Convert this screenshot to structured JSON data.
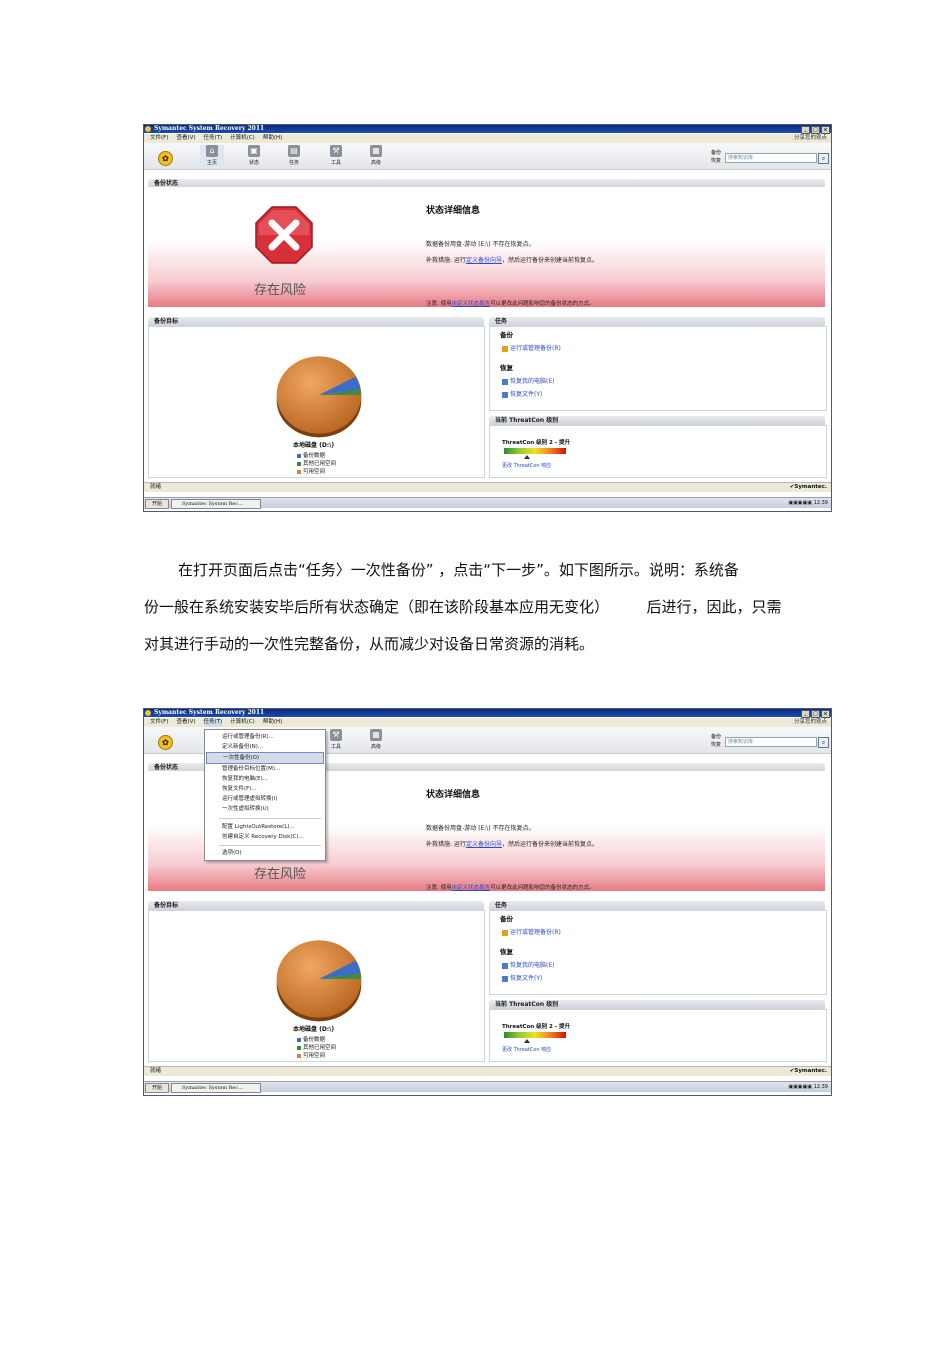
{
  "window": {
    "title": "Symantec System Recovery 2011",
    "share_link": "分享您的观点",
    "buttons": [
      "_",
      "□",
      "×"
    ]
  },
  "menus": [
    "文件(F)",
    "查看(V)",
    "任务(T)",
    "计算机(C)",
    "帮助(H)"
  ],
  "toolbar": {
    "tabs": [
      "主页",
      "状态",
      "任务",
      "工具",
      "高级"
    ],
    "quick": [
      "备份",
      "恢复"
    ],
    "search_placeholder": "搜索知识库",
    "search_icon": "magnifier-icon"
  },
  "backup_status": {
    "header": "备份状态",
    "risk_label": "存在风险",
    "detail_title": "状态详细信息",
    "line1": "数据备份用盘-游动 (E:\\) 不存在恢复点。",
    "line2_prefix": "补救措施: 运行",
    "line2_link": "定义备份向导",
    "line2_suffix": "，然后运行备份来创建当前恢复点。",
    "note_prefix": "注意: 使用",
    "note_link": "自定义状态报告",
    "note_suffix": "可以更改此问题影响您的备份状态的方式。"
  },
  "backup_target": {
    "header": "备份目标",
    "drive_label": "本地磁盘 (D:\\)",
    "legend": [
      {
        "label": "备份数据",
        "color": "#3a6cc8"
      },
      {
        "label": "其他已用空间",
        "color": "#3c8c3c"
      },
      {
        "label": "可用空间",
        "color": "#d8843c"
      }
    ]
  },
  "tasks": {
    "header": "任务",
    "backup_group": "备份",
    "backup_link": "运行或管理备份(R)",
    "restore_group": "恢复",
    "restore_links": [
      "恢复我的电脑(E)",
      "恢复文件(Y)"
    ]
  },
  "threatcon": {
    "header": "当前 ThreatCon 级别",
    "level": "ThreatCon 级别 2 - 提升",
    "link": "更改 ThreatCon 响应"
  },
  "statusbar": {
    "text": "就绪",
    "brand": "Symantec."
  },
  "taskbar": {
    "start": "开始",
    "item": "Symantec System Rec...",
    "clock": "12:39"
  },
  "task_menu": {
    "items": [
      "运行或管理备份(R)...",
      "定义新备份(N)...",
      "一次性备份(O)",
      "管理备份目标位置(M)...",
      "恢复我的电脑(E)...",
      "恢复文件(F)...",
      "运行或管理虚拟转换(I)",
      "一次性虚拟转换(U)",
      "配置 LightsOutRestore(L)...",
      "创建自定义 Recovery Disk(C)...",
      "选项(O)"
    ],
    "selected_index": 2
  },
  "paragraph": {
    "lines": [
      "在打开页面后点击“任务〉一次性备份” ，点击“下一步”。如下图所示。说明：系统备",
      "份一般在系统安装安毕后所有状态确定（即在该阶段基本应用无变化）　　　后进行，因此，只需",
      "对其进行手动的一次性完整备份，从而减少对设备日常资源的消耗。"
    ]
  }
}
